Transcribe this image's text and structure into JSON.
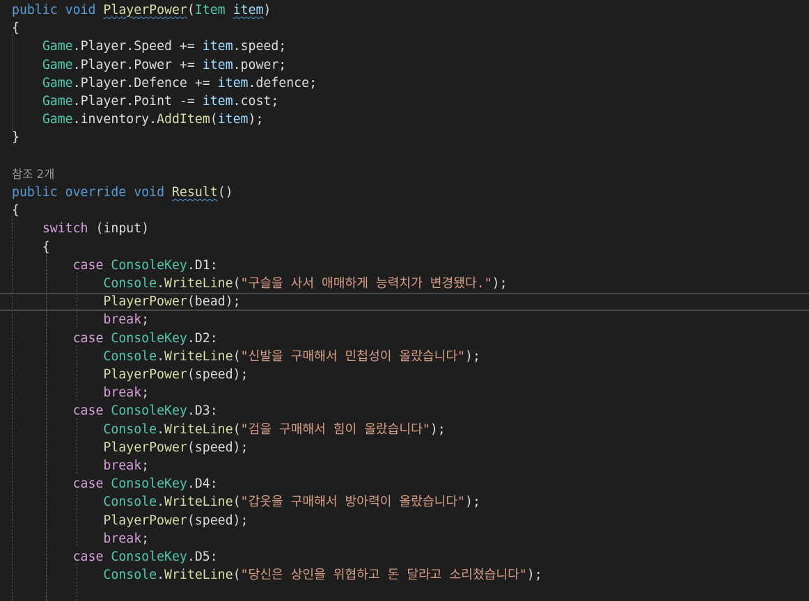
{
  "editor": {
    "language": "C#",
    "theme_colors": {
      "background": "#1e1e1e",
      "keyword": "#569cd6",
      "control": "#d8a0df",
      "type": "#4ec9b0",
      "method": "#dcdcaa",
      "parameter": "#9cdcfe",
      "string": "#d69d85",
      "text": "#dcdcdc",
      "codelens": "#999999"
    },
    "codelens": {
      "references": "참조 2개"
    },
    "lines": [
      {
        "tokens": [
          [
            "kw",
            "public"
          ],
          [
            "punc",
            " "
          ],
          [
            "kw",
            "void"
          ],
          [
            "punc",
            " "
          ],
          [
            "meth",
            "PlayerPower",
            1
          ],
          [
            "punc",
            "("
          ],
          [
            "type",
            "Item"
          ],
          [
            "punc",
            " "
          ],
          [
            "param",
            "item",
            1
          ],
          [
            "punc",
            ")"
          ]
        ]
      },
      {
        "tokens": [
          [
            "punc",
            "{"
          ]
        ]
      },
      {
        "tokens": [
          [
            "punc",
            "    "
          ],
          [
            "type",
            "Game"
          ],
          [
            "punc",
            ".Player.Speed += "
          ],
          [
            "param",
            "item"
          ],
          [
            "punc",
            ".speed;"
          ]
        ]
      },
      {
        "tokens": [
          [
            "punc",
            "    "
          ],
          [
            "type",
            "Game"
          ],
          [
            "punc",
            ".Player.Power += "
          ],
          [
            "param",
            "item"
          ],
          [
            "punc",
            ".power;"
          ]
        ]
      },
      {
        "tokens": [
          [
            "punc",
            "    "
          ],
          [
            "type",
            "Game"
          ],
          [
            "punc",
            ".Player.Defence += "
          ],
          [
            "param",
            "item"
          ],
          [
            "punc",
            ".defence;"
          ]
        ]
      },
      {
        "tokens": [
          [
            "punc",
            "    "
          ],
          [
            "type",
            "Game"
          ],
          [
            "punc",
            ".Player.Point -= "
          ],
          [
            "param",
            "item"
          ],
          [
            "punc",
            ".cost;"
          ]
        ]
      },
      {
        "tokens": [
          [
            "punc",
            "    "
          ],
          [
            "type",
            "Game"
          ],
          [
            "punc",
            ".inventory."
          ],
          [
            "meth",
            "AddItem"
          ],
          [
            "punc",
            "("
          ],
          [
            "param",
            "item"
          ],
          [
            "punc",
            ");"
          ]
        ]
      },
      {
        "tokens": [
          [
            "punc",
            "}"
          ]
        ]
      },
      {
        "tokens": []
      },
      {
        "lens": true
      },
      {
        "tokens": [
          [
            "kw",
            "public"
          ],
          [
            "punc",
            " "
          ],
          [
            "kw",
            "override"
          ],
          [
            "punc",
            " "
          ],
          [
            "kw",
            "void"
          ],
          [
            "punc",
            " "
          ],
          [
            "meth",
            "Result",
            1
          ],
          [
            "punc",
            "()"
          ]
        ]
      },
      {
        "tokens": [
          [
            "punc",
            "{"
          ]
        ]
      },
      {
        "tokens": [
          [
            "punc",
            "    "
          ],
          [
            "ctl",
            "switch"
          ],
          [
            "punc",
            " (input)"
          ]
        ]
      },
      {
        "tokens": [
          [
            "punc",
            "    {"
          ]
        ]
      },
      {
        "tokens": [
          [
            "punc",
            "        "
          ],
          [
            "ctl",
            "case"
          ],
          [
            "punc",
            " "
          ],
          [
            "type",
            "ConsoleKey"
          ],
          [
            "punc",
            ".D1:"
          ]
        ]
      },
      {
        "tokens": [
          [
            "punc",
            "            "
          ],
          [
            "type",
            "Console"
          ],
          [
            "punc",
            "."
          ],
          [
            "meth",
            "WriteLine"
          ],
          [
            "punc",
            "("
          ],
          [
            "str",
            "\"구슬을 사서 애매하게 능력치가 변경됐다.\""
          ],
          [
            "punc",
            ");"
          ]
        ]
      },
      {
        "current": true,
        "tokens": [
          [
            "punc",
            "            "
          ],
          [
            "meth",
            "PlayerPower"
          ],
          [
            "punc",
            "(bead);"
          ]
        ]
      },
      {
        "tokens": [
          [
            "punc",
            "            "
          ],
          [
            "ctl",
            "break"
          ],
          [
            "punc",
            ";"
          ]
        ]
      },
      {
        "tokens": [
          [
            "punc",
            "        "
          ],
          [
            "ctl",
            "case"
          ],
          [
            "punc",
            " "
          ],
          [
            "type",
            "ConsoleKey"
          ],
          [
            "punc",
            ".D2:"
          ]
        ]
      },
      {
        "tokens": [
          [
            "punc",
            "            "
          ],
          [
            "type",
            "Console"
          ],
          [
            "punc",
            "."
          ],
          [
            "meth",
            "WriteLine"
          ],
          [
            "punc",
            "("
          ],
          [
            "str",
            "\"신발을 구매해서 민첩성이 올랐습니다\""
          ],
          [
            "punc",
            ");"
          ]
        ]
      },
      {
        "tokens": [
          [
            "punc",
            "            "
          ],
          [
            "meth",
            "PlayerPower"
          ],
          [
            "punc",
            "(speed);"
          ]
        ]
      },
      {
        "tokens": [
          [
            "punc",
            "            "
          ],
          [
            "ctl",
            "break"
          ],
          [
            "punc",
            ";"
          ]
        ]
      },
      {
        "tokens": [
          [
            "punc",
            "        "
          ],
          [
            "ctl",
            "case"
          ],
          [
            "punc",
            " "
          ],
          [
            "type",
            "ConsoleKey"
          ],
          [
            "punc",
            ".D3:"
          ]
        ]
      },
      {
        "tokens": [
          [
            "punc",
            "            "
          ],
          [
            "type",
            "Console"
          ],
          [
            "punc",
            "."
          ],
          [
            "meth",
            "WriteLine"
          ],
          [
            "punc",
            "("
          ],
          [
            "str",
            "\"검을 구매해서 힘이 올랐습니다\""
          ],
          [
            "punc",
            ");"
          ]
        ]
      },
      {
        "tokens": [
          [
            "punc",
            "            "
          ],
          [
            "meth",
            "PlayerPower"
          ],
          [
            "punc",
            "(speed);"
          ]
        ]
      },
      {
        "tokens": [
          [
            "punc",
            "            "
          ],
          [
            "ctl",
            "break"
          ],
          [
            "punc",
            ";"
          ]
        ]
      },
      {
        "tokens": [
          [
            "punc",
            "        "
          ],
          [
            "ctl",
            "case"
          ],
          [
            "punc",
            " "
          ],
          [
            "type",
            "ConsoleKey"
          ],
          [
            "punc",
            ".D4:"
          ]
        ]
      },
      {
        "tokens": [
          [
            "punc",
            "            "
          ],
          [
            "type",
            "Console"
          ],
          [
            "punc",
            "."
          ],
          [
            "meth",
            "WriteLine"
          ],
          [
            "punc",
            "("
          ],
          [
            "str",
            "\"갑옷을 구매해서 방아력이 올랐습니다\""
          ],
          [
            "punc",
            ");"
          ]
        ]
      },
      {
        "tokens": [
          [
            "punc",
            "            "
          ],
          [
            "meth",
            "PlayerPower"
          ],
          [
            "punc",
            "(speed);"
          ]
        ]
      },
      {
        "tokens": [
          [
            "punc",
            "            "
          ],
          [
            "ctl",
            "break"
          ],
          [
            "punc",
            ";"
          ]
        ]
      },
      {
        "tokens": [
          [
            "punc",
            "        "
          ],
          [
            "ctl",
            "case"
          ],
          [
            "punc",
            " "
          ],
          [
            "type",
            "ConsoleKey"
          ],
          [
            "punc",
            ".D5:"
          ]
        ]
      },
      {
        "tokens": [
          [
            "punc",
            "            "
          ],
          [
            "type",
            "Console"
          ],
          [
            "punc",
            "."
          ],
          [
            "meth",
            "WriteLine"
          ],
          [
            "punc",
            "("
          ],
          [
            "str",
            "\"당신은 상인을 위협하고 돈 달라고 소리쳤습니다\""
          ],
          [
            "punc",
            ");"
          ]
        ]
      }
    ]
  }
}
